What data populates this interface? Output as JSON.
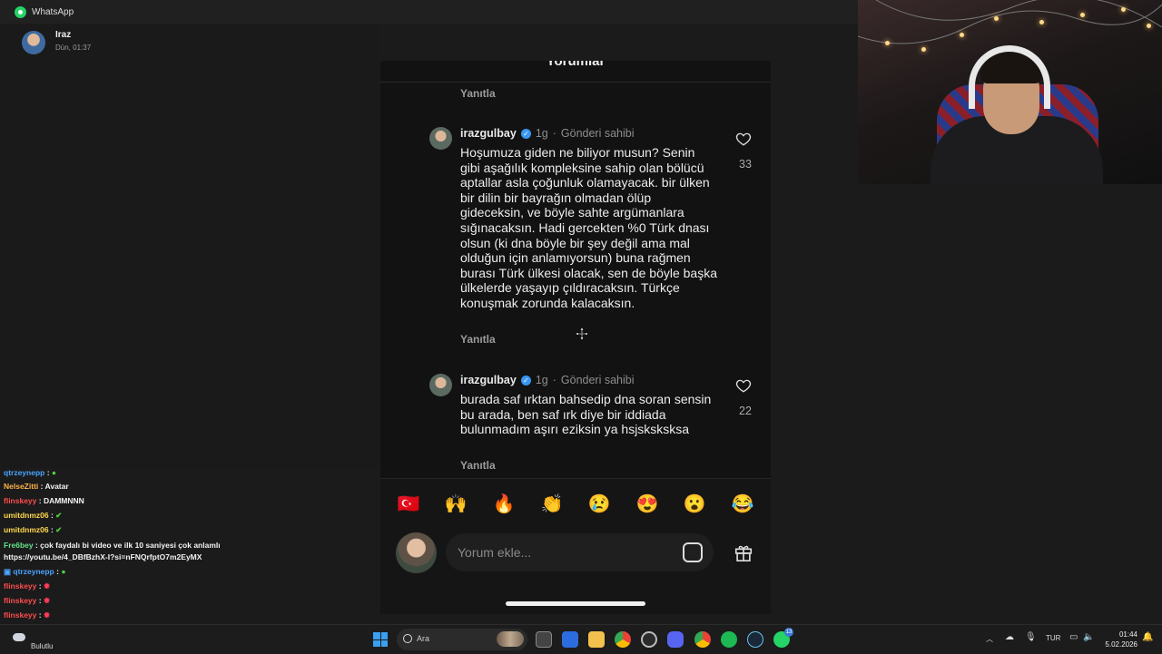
{
  "window": {
    "title": "WhatsApp"
  },
  "chat_header": {
    "name": "Iraz",
    "time": "Dün, 01:37"
  },
  "post": {
    "title": "Yorumlar",
    "more": "···",
    "reply_label": "Yanıtla",
    "comments": [
      {
        "user": "irazgulbay",
        "age": "1g",
        "badge": "Gönderi sahibi",
        "text": "Hoşumuza giden ne biliyor musun? Senin gibi aşağılık kompleksine sahip olan bölücü aptallar asla çoğunluk olamayacak. bir ülken bir dilin bir bayrağın olmadan ölüp gideceksin, ve böyle sahte argümanlara sığınacaksın. Hadi gercekten %0 Türk dnası olsun (ki dna böyle bir şey değil ama mal olduğun için anlamıyorsun) buna rağmen burası Türk ülkesi olacak, sen de böyle başka ülkelerde yaşayıp çıldıracaksın. Türkçe konuşmak zorunda kalacaksın.",
        "likes": "33"
      },
      {
        "user": "irazgulbay",
        "age": "1g",
        "badge": "Gönderi sahibi",
        "text": "burada saf ırktan bahsedip dna soran sensin bu arada, ben saf ırk diye bir iddiada bulunmadım aşırı eziksin ya hsjsksksksa",
        "likes": "22"
      }
    ],
    "emojis": [
      "🇹🇷",
      "🙌",
      "🔥",
      "👏",
      "😢",
      "😍",
      "😮",
      "😂"
    ],
    "input_placeholder": "Yorum ekle..."
  },
  "stream_chat": [
    {
      "name": "qtrzeynepp",
      "color": "#4aa3ff",
      "text": "",
      "emote": "green",
      "prefix_icon": false
    },
    {
      "name": "NelseZitti",
      "color": "#ffb347",
      "text": "Avatar",
      "emote": "",
      "prefix_icon": false
    },
    {
      "name": "flinskeyy",
      "color": "#ff4d4d",
      "text": "DAMMNNN",
      "emote": "",
      "prefix_icon": false
    },
    {
      "name": "umitdnmz06",
      "color": "#ffd84d",
      "text": "",
      "emote": "green",
      "prefix_icon": false
    },
    {
      "name": "umitdnmz06",
      "color": "#ffd84d",
      "text": "",
      "emote": "green",
      "prefix_icon": false
    },
    {
      "name": "Fre6bey",
      "color": "#66e28a",
      "text": "çok faydalı bi video ve ilk 10 saniyesi çok anlamlı",
      "emote": "",
      "prefix_icon": false
    },
    {
      "name": "",
      "color": "#ffffff",
      "text": "https://youtu.be/4_DBfBzhX-I?si=nFNQrfptO7m2EyMX",
      "emote": "",
      "prefix_icon": false
    },
    {
      "name": "qtrzeynepp",
      "color": "#4aa3ff",
      "text": "",
      "emote": "green",
      "prefix_icon": true
    },
    {
      "name": "flinskeyy",
      "color": "#ff4d4d",
      "text": "",
      "emote": "red",
      "prefix_icon": false
    },
    {
      "name": "flinskeyy",
      "color": "#ff4d4d",
      "text": "",
      "emote": "red",
      "prefix_icon": false
    },
    {
      "name": "flinskeyy",
      "color": "#ff4d4d",
      "text": "",
      "emote": "red",
      "prefix_icon": false
    },
    {
      "name": "umitdnmz06",
      "color": "#ffd84d",
      "text": "",
      "emote": "green",
      "prefix_icon": false
    }
  ],
  "taskbar": {
    "weather_label": "Bulutlu",
    "search_label": "Ara",
    "badge_count": "13",
    "language": "TUR",
    "time": "01:44",
    "date": "5.02.2026"
  }
}
